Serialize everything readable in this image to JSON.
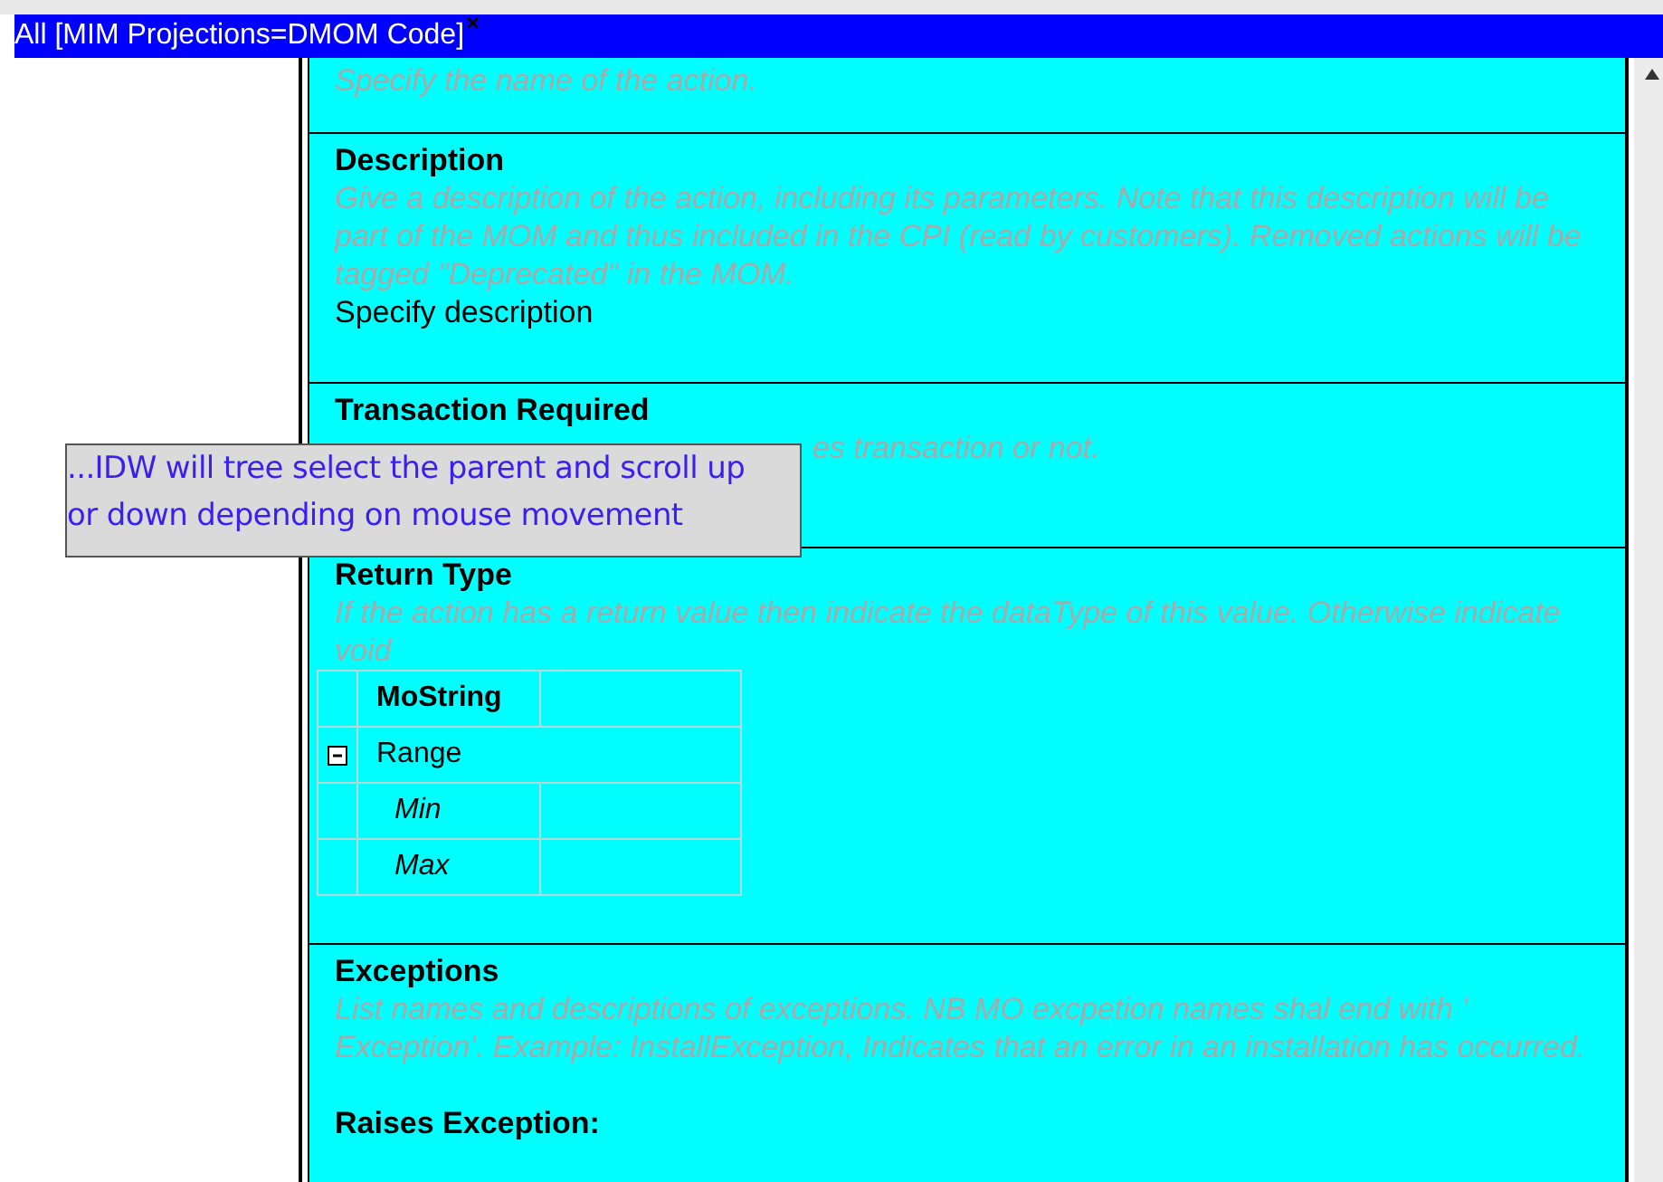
{
  "title_bar": {
    "title": "All [MIM Projections=DMOM Code]",
    "close": "×"
  },
  "sections": [
    {
      "hint": "Specify the name of the action."
    },
    {
      "title": "Description",
      "hint": "Give a description of the action, including its parameters. Note that this description will be part of the MOM and thus included in the CPI (read by customers). Removed actions will be tagged \"Deprecated\" in the MOM.",
      "value": "Specify description"
    },
    {
      "title": "Transaction Required",
      "hint": "es transaction or not."
    },
    {
      "title": "Return Type",
      "hint": "If the action has a return value then indicate the dataType of this value. Otherwise indicate void",
      "type_table": {
        "type_name": "MoString",
        "group": {
          "label": "Range",
          "expanded": true,
          "fields": [
            "Min",
            "Max"
          ]
        }
      }
    },
    {
      "title": "Exceptions",
      "hint": "List names and descriptions of exceptions. NB MO excpetion names shal end with ' Exception'. Example: InstallException, Indicates that an error in an installation has occurred.",
      "subtitle": "Raises Exception:"
    }
  ],
  "tooltip": {
    "text": "...IDW will tree select the parent and scroll up or down depending on mouse movement"
  }
}
